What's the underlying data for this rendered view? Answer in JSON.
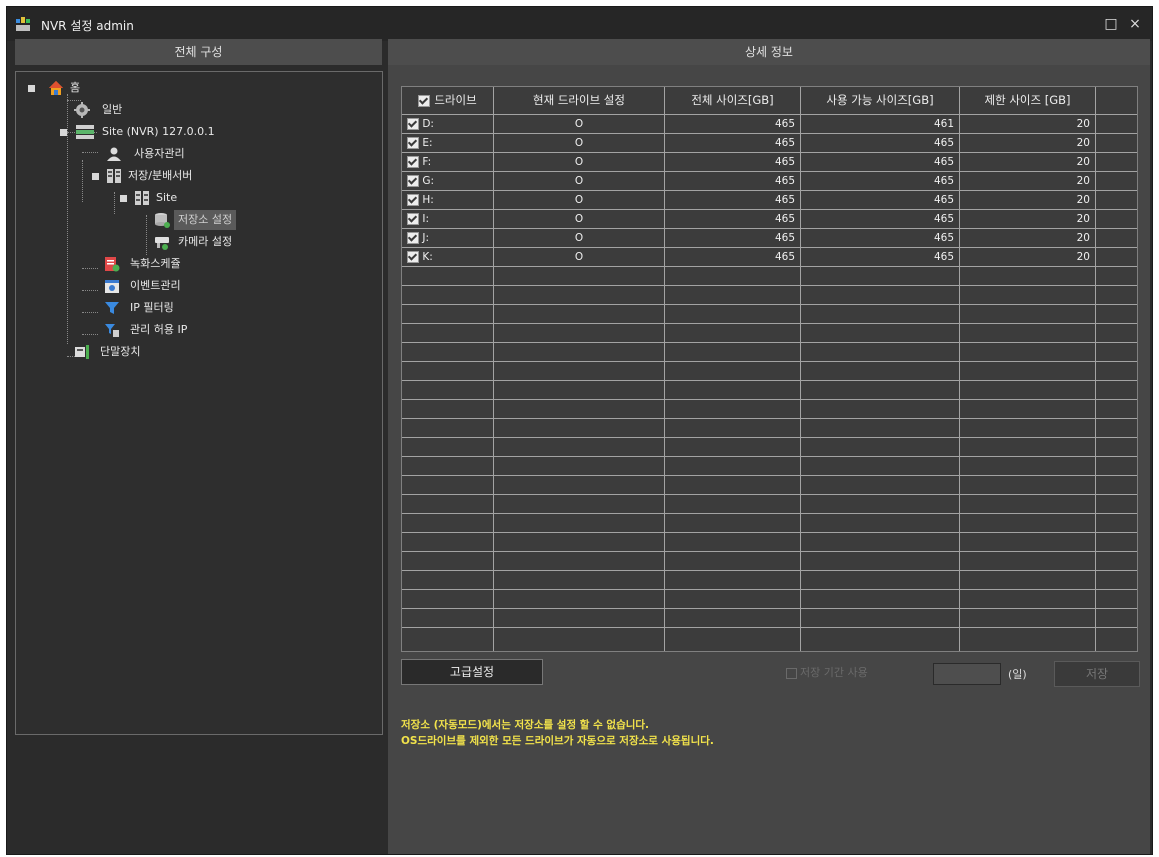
{
  "window": {
    "title": "NVR 설정 admin",
    "maximize_glyph": "□",
    "close_glyph": "×"
  },
  "left_panel": {
    "header": "전체 구성",
    "tree": [
      {
        "label": "홈",
        "icon": "home-icon",
        "expander": true
      },
      {
        "label": "일반",
        "icon": "gear-icon",
        "expander": false
      },
      {
        "label": "Site (NVR) 127.0.0.1",
        "icon": "server-icon",
        "expander": true
      },
      {
        "label": "사용자관리",
        "icon": "user-icon",
        "expander": false
      },
      {
        "label": "저장/분배서버",
        "icon": "storage-server-icon",
        "expander": true
      },
      {
        "label": "Site",
        "icon": "site-icon",
        "expander": true
      },
      {
        "label": "저장소 설정",
        "icon": "storage-icon",
        "expander": false,
        "selected": true
      },
      {
        "label": "카메라 설정",
        "icon": "camera-icon",
        "expander": false
      },
      {
        "label": "녹화스케쥴",
        "icon": "schedule-icon",
        "expander": false
      },
      {
        "label": "이벤트관리",
        "icon": "event-icon",
        "expander": false
      },
      {
        "label": "IP 필터링",
        "icon": "filter-icon",
        "expander": false
      },
      {
        "label": "관리 허용 IP",
        "icon": "filter-doc-icon",
        "expander": false
      },
      {
        "label": "단말장치",
        "icon": "device-icon",
        "expander": false
      }
    ]
  },
  "right_panel": {
    "header": "상세 정보",
    "table": {
      "columns": [
        "드라이브",
        "현재 드라이브 설정",
        "전체 사이즈[GB]",
        "사용 가능 사이즈[GB]",
        "제한 사이즈 [GB]"
      ],
      "rows": [
        {
          "drive": "D:",
          "setting": "O",
          "total": "465",
          "available": "461",
          "limit": "20"
        },
        {
          "drive": "E:",
          "setting": "O",
          "total": "465",
          "available": "465",
          "limit": "20"
        },
        {
          "drive": "F:",
          "setting": "O",
          "total": "465",
          "available": "465",
          "limit": "20"
        },
        {
          "drive": "G:",
          "setting": "O",
          "total": "465",
          "available": "465",
          "limit": "20"
        },
        {
          "drive": "H:",
          "setting": "O",
          "total": "465",
          "available": "465",
          "limit": "20"
        },
        {
          "drive": "I:",
          "setting": "O",
          "total": "465",
          "available": "465",
          "limit": "20"
        },
        {
          "drive": "J:",
          "setting": "O",
          "total": "465",
          "available": "465",
          "limit": "20"
        },
        {
          "drive": "K:",
          "setting": "O",
          "total": "465",
          "available": "465",
          "limit": "20"
        }
      ]
    },
    "advanced_button": "고급설정",
    "retention_checkbox_label": "저장 기간 사용",
    "days_input_value": "",
    "days_unit": "(일)",
    "save_button": "저장",
    "notice_line1": "저장소 (자동모드)에서는 저장소를 설정 할 수 없습니다.",
    "notice_line2": "OS드라이브를 제외한 모든 드라이브가 자동으로 저장소로 사용됩니다."
  },
  "colors": {
    "background": "#2b2b2b",
    "panel_header": "#4d4d4d",
    "notice_text": "#f2e34b",
    "selected_tree_item": "#5a5a5a"
  }
}
